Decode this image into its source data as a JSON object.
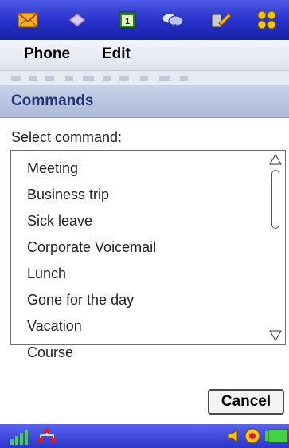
{
  "app_icons": [
    "messages-icon",
    "contacts-icon",
    "calendar-icon",
    "chat-icon",
    "tools-icon",
    "apps-grid-icon"
  ],
  "menu": {
    "phone": "Phone",
    "edit": "Edit"
  },
  "title": "Commands",
  "prompt": "Select command:",
  "commands": [
    "Meeting",
    "Business trip",
    "Sick leave",
    "Corporate Voicemail",
    "Lunch",
    "Gone for the day",
    "Vacation",
    "Course"
  ],
  "cancel_label": "Cancel",
  "status_icons": [
    "signal-strength-icon",
    "network-icon",
    "volume-icon",
    "sound-icon",
    "battery-icon"
  ],
  "colors": {
    "appbar": "#2a33cc",
    "title_text": "#23357a",
    "accent": "#5b64ec"
  }
}
